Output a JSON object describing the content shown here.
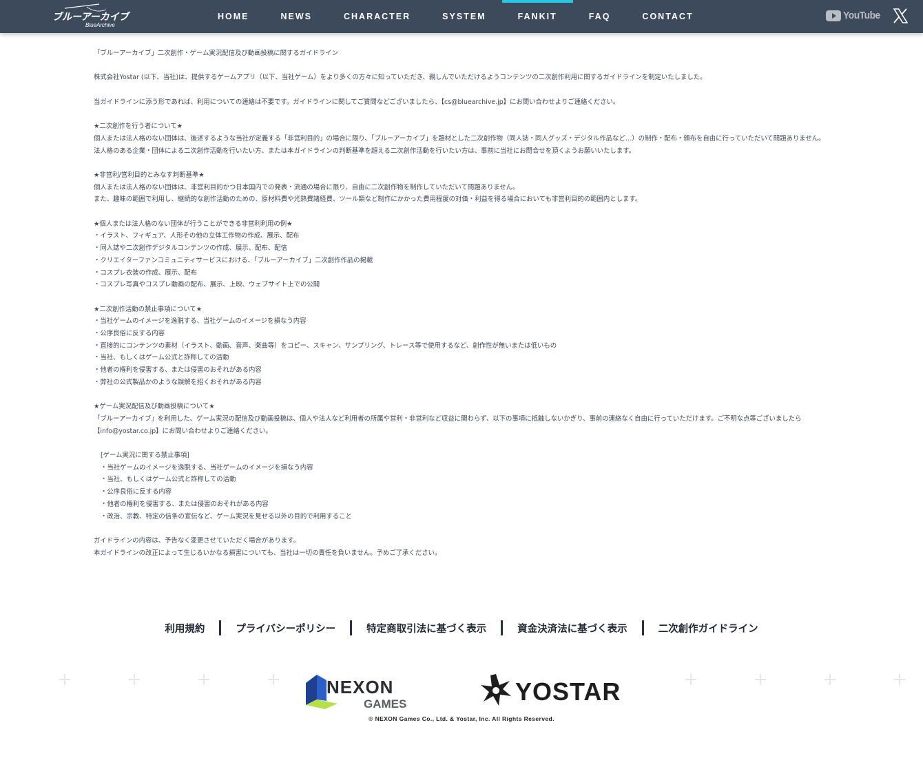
{
  "header": {
    "logo_text": "ブルーアーカイブ",
    "logo_sub": "BlueArchive",
    "nav": [
      "HOME",
      "NEWS",
      "CHARACTER",
      "SYSTEM",
      "FANKIT",
      "FAQ",
      "CONTACT"
    ],
    "active_nav": "FANKIT",
    "youtube_label": "YouTube",
    "accent_color": "#27c7e6",
    "bg_color": "#3d4a5c"
  },
  "guideline": {
    "title": "「ブルーアーカイブ」二次創作・ゲーム実況配信及び動画投稿に関するガイドライン",
    "intro": "株式会社Yostar (以下、当社)は、提供するゲームアプリ（以下、当社ゲーム）をより多くの方々に知っていただき、親しんでいただけるようコンテンツの二次創作利用に関するガイドラインを制定いたしました。",
    "contact": "当ガイドラインに添う形であれば、利用についての連絡は不要です。ガイドラインに関してご質問などございましたら、【cs@bluearchive.jp】にお問い合わせよりご連絡ください。",
    "s1_head": "★二次創作を行う者について★",
    "s1_p1": "個人または法人格のない団体は、後述するような当社が定義する「非営利目的」の場合に限り、「ブルーアーカイブ」を題材とした二次創作物（同人誌・同人グッズ・デジタル作品など…）の制作・配布・頒布を自由に行っていただいて問題ありません。",
    "s1_p2": "法人格のある企業・団体による二次創作活動を行いたい方、または本ガイドラインの判断基準を超える二次創作活動を行いたい方は、事前に当社にお問合せを頂くようお願いいたします。",
    "s2_head": "★非営利/営利目的とみなす判断基準★",
    "s2_p1": "個人または法人格のない団体は、非営利目的かつ日本国内での発表・流通の場合に限り、自由に二次創作物を制作していただいて問題ありません。",
    "s2_p2": "また、趣味の範囲で利用し、継続的な創作活動のための、原材料費や光熱費諸経費、ツール類など制作にかかった費用程度の対価・利益を得る場合においても非営利目的の範囲内とします。",
    "s3_head": "★個人または法人格のない団体が行うことができる非営利利用の例★",
    "s3_items": [
      "・イラスト、フィギュア、人形その他の立体工作物の作成、展示、配布",
      "・同人誌や二次創作デジタルコンテンツの作成、展示、配布、配信",
      "・クリエイターファンコミュニティサービスにおける、「ブルーアーカイブ」二次創作作品の掲載",
      "・コスプレ衣装の作成、展示、配布",
      "・コスプレ写真やコスプレ動画の配布、展示、上映、ウェブサイト上での公開"
    ],
    "s4_head": "★二次創作活動の禁止事項について★",
    "s4_items": [
      "・当社ゲームのイメージを逸脱する、当社ゲームのイメージを損なう内容",
      "・公序良俗に反する内容",
      "・直接的にコンテンツの素材（イラスト、動画、音声、楽曲等）をコピー、スキャン、サンプリング、トレース等で使用するなど、創作性が無いまたは低いもの",
      "・当社、もしくはゲーム公式と詐称しての活動",
      "・他者の権利を侵害する、または侵害のおそれがある内容",
      "・弊社の公式製品かのような誤解を招くおそれがある内容"
    ],
    "s5_head": "★ゲーム実況配信及び動画投稿について★",
    "s5_p1": "「ブルーアーカイブ」を利用した、ゲーム実況の配信及び動画投稿は、個人や法人など利用者の所属や営利・非営利など収益に関わらず、以下の事項に抵触しないかぎり、事前の連絡なく自由に行っていただけます。ご不明な点等ございましたら【info@yostar.co.jp】にお問い合わせよりご連絡ください。",
    "s6_head": "[ゲーム実況に関する禁止事項]",
    "s6_items": [
      "・当社ゲームのイメージを逸脱する、当社ゲームのイメージを損なう内容",
      "・当社、もしくはゲーム公式と詐称しての活動",
      "・公序良俗に反する内容",
      "・他者の権利を侵害する、または侵害のおそれがある内容",
      "・政治、宗教、特定の信条の宣伝など、ゲーム実況を見せる以外の目的で利用すること"
    ],
    "closing1": "ガイドラインの内容は、予告なく変更させていただく場合があります。",
    "closing2": "本ガイドラインの改正によって生じるいかなる損害についても、当社は一切の責任を負いません。予めご了承ください。"
  },
  "footer": {
    "links": [
      "利用規約",
      "プライバシーポリシー",
      "特定商取引法に基づく表示",
      "資金決済法に基づく表示",
      "二次創作ガイドライン"
    ],
    "nexon_logo_top": "NEXON",
    "nexon_logo_bottom": "GAMES",
    "yostar_logo": "YOSTAR",
    "copyright": "© NEXON Games Co., Ltd. & Yostar, Inc. All Rights Reserved."
  }
}
